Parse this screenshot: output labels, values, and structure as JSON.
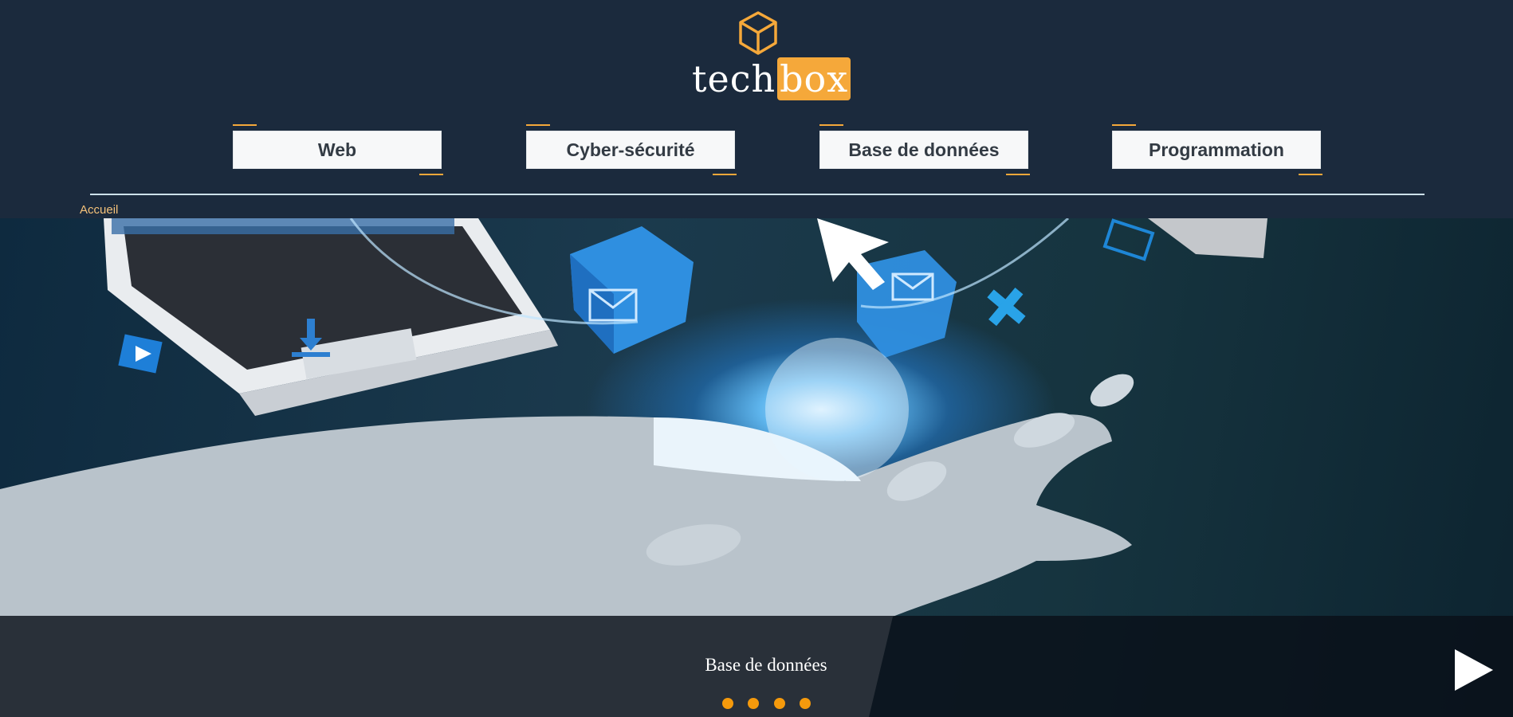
{
  "brand": {
    "name_part1": "tech",
    "name_part2": "box",
    "accent": "#f5a83a",
    "logo_icon": "cube-icon"
  },
  "nav": {
    "items": [
      {
        "label": "Web"
      },
      {
        "label": "Cyber-sécurité"
      },
      {
        "label": "Base de données"
      },
      {
        "label": "Programmation"
      }
    ]
  },
  "breadcrumb": {
    "label": "Accueil"
  },
  "carousel": {
    "caption": "Base de données",
    "slide_count": 4,
    "next_icon": "play-arrow-icon",
    "dot_color": "#f59a0c"
  },
  "colors": {
    "header_bg": "#1b2a3d",
    "divider": "#cde0ea"
  }
}
